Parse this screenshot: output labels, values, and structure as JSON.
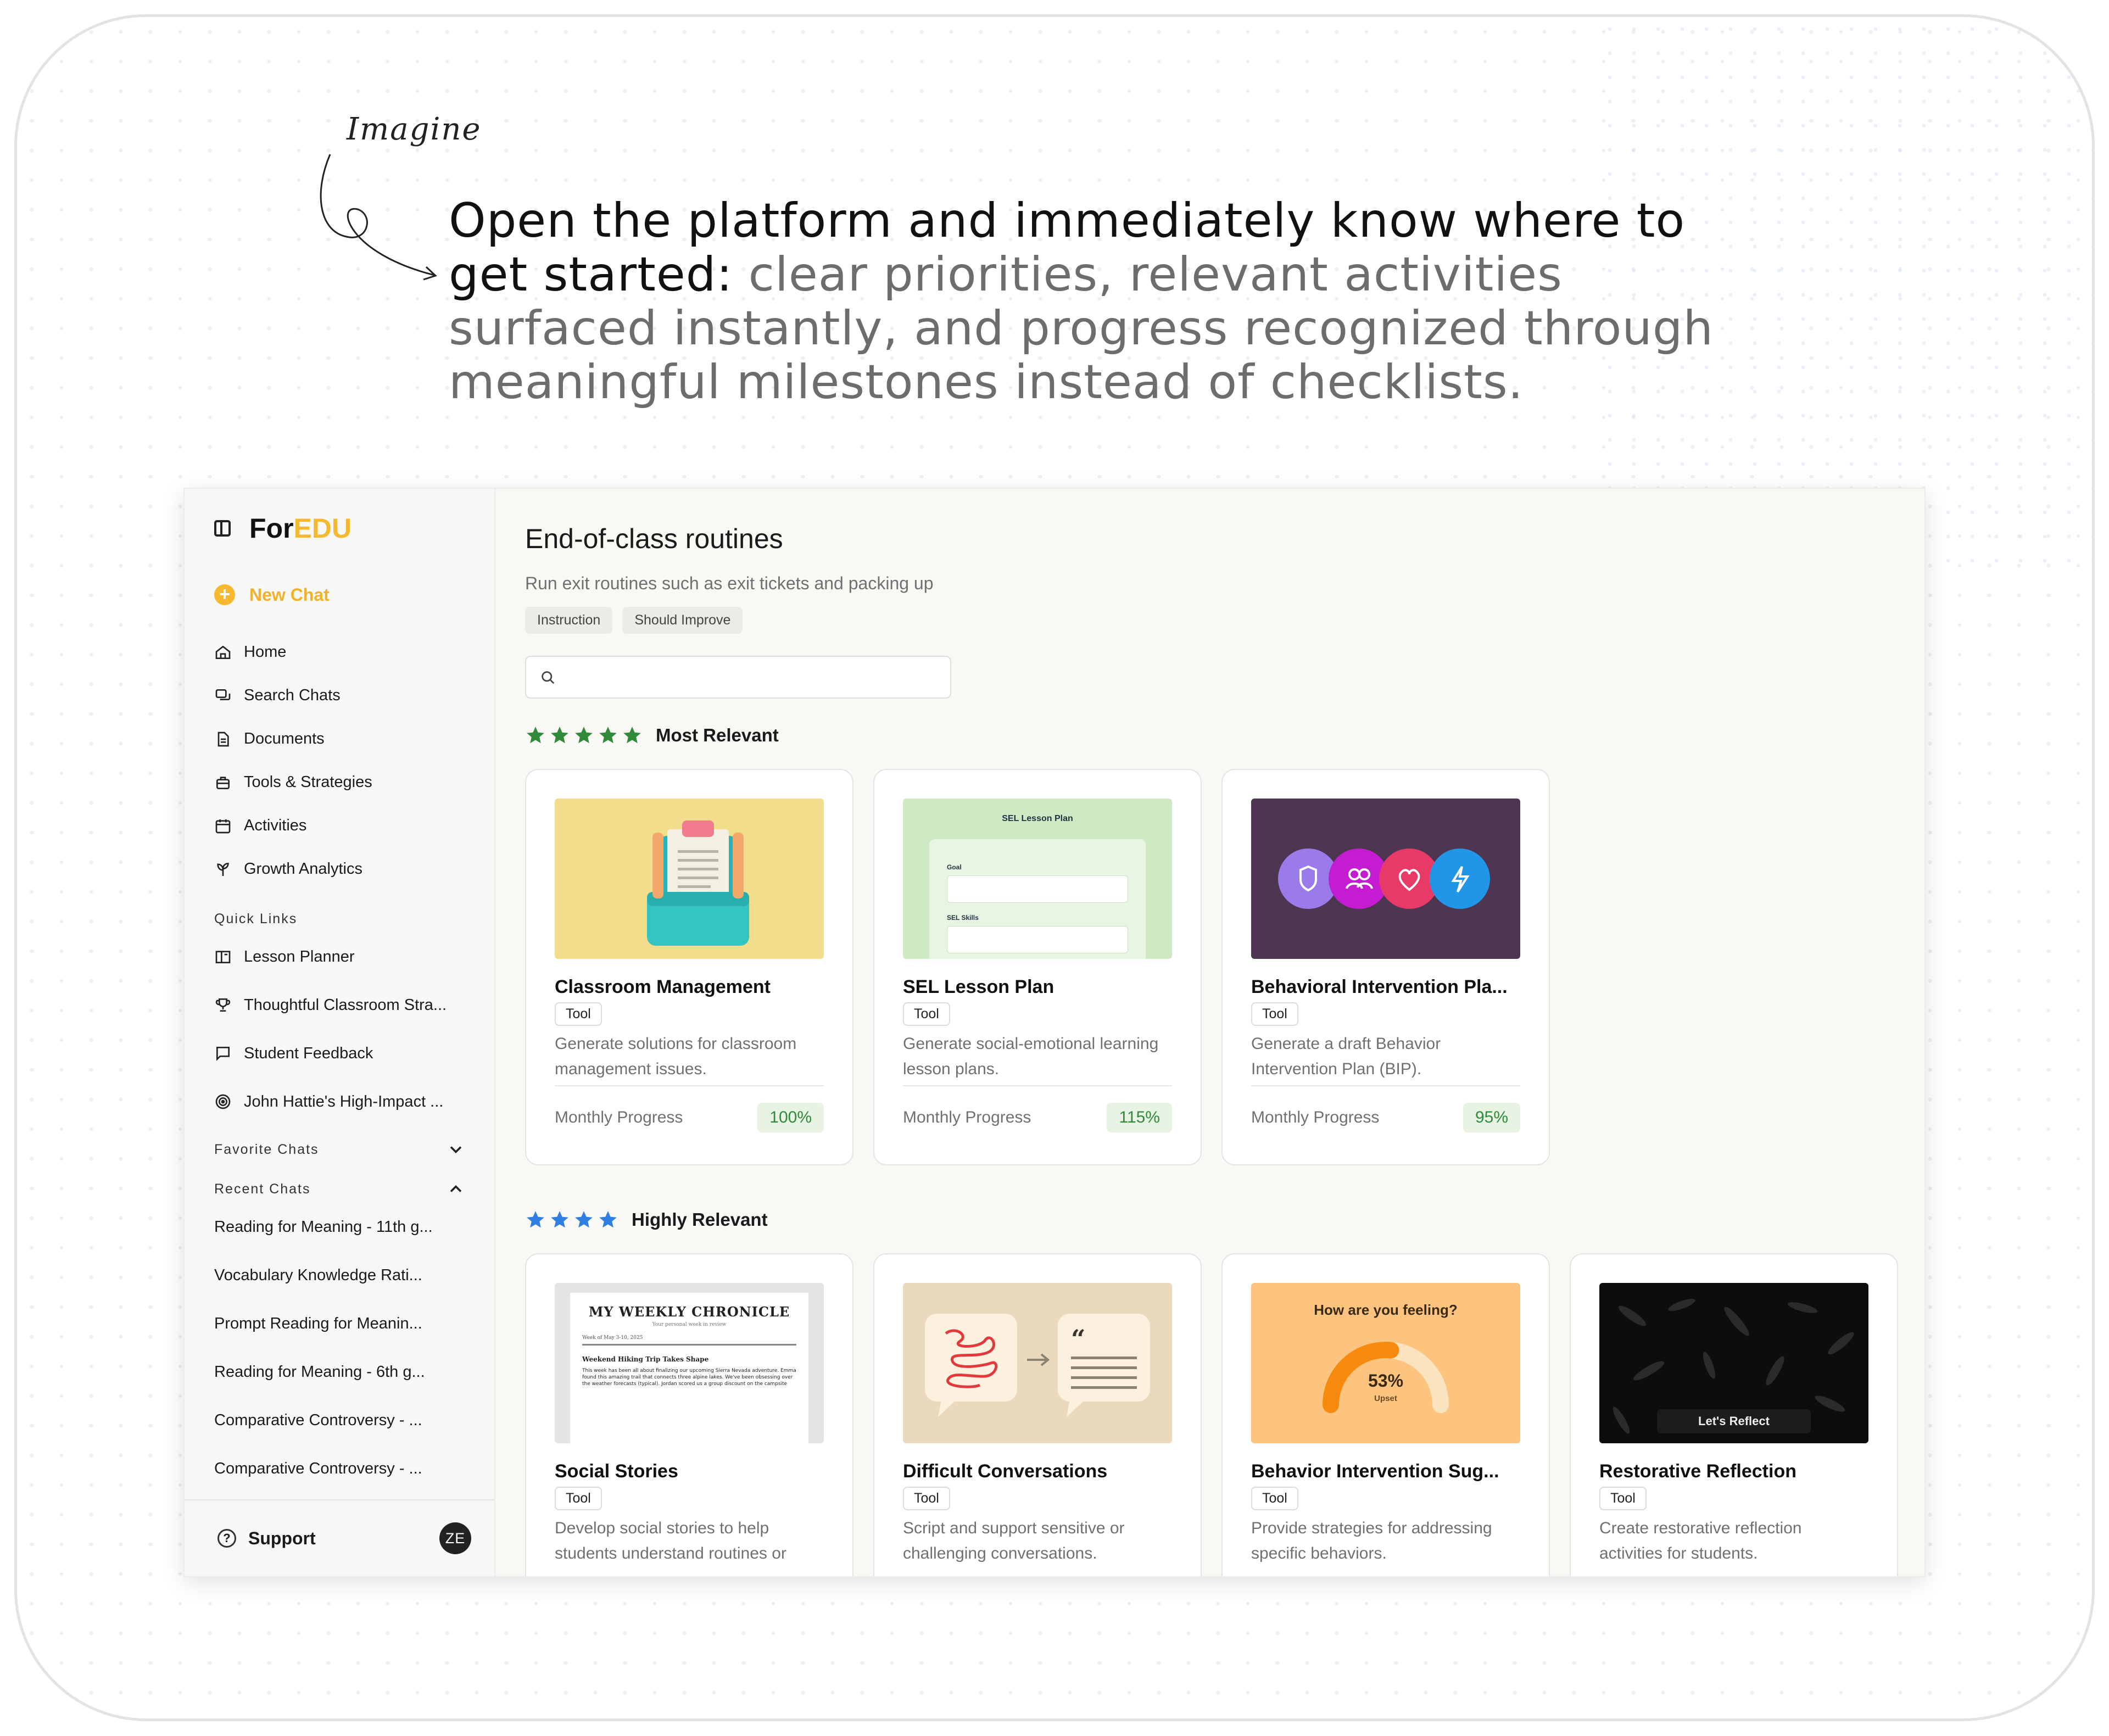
{
  "hero": {
    "imagine": "Imagine",
    "headline_strong": "Open the platform and immediately know where to get started:",
    "headline_muted": " clear priorities, relevant activities surfaced instantly, and progress recognized through meaningful milestones instead of checklists."
  },
  "brand": {
    "part1": "For",
    "part2": "EDU"
  },
  "sidebar": {
    "new_chat": "New Chat",
    "nav": [
      {
        "label": "Home",
        "icon": "home-icon"
      },
      {
        "label": "Search Chats",
        "icon": "chats-icon"
      },
      {
        "label": "Documents",
        "icon": "document-icon"
      },
      {
        "label": "Tools & Strategies",
        "icon": "tools-icon"
      },
      {
        "label": "Activities",
        "icon": "calendar-icon"
      },
      {
        "label": "Growth Analytics",
        "icon": "growth-icon"
      }
    ],
    "quick_links_label": "Quick Links",
    "quick_links": [
      {
        "label": "Lesson Planner",
        "icon": "book-icon"
      },
      {
        "label": "Thoughtful Classroom Stra...",
        "icon": "trophy-icon"
      },
      {
        "label": "Student Feedback",
        "icon": "comment-icon"
      },
      {
        "label": "John Hattie's High-Impact ...",
        "icon": "target-icon"
      }
    ],
    "favorite_chats_label": "Favorite Chats",
    "recent_chats_label": "Recent Chats",
    "recent_chats": [
      "Reading for Meaning - 11th g...",
      "Vocabulary Knowledge Rati...",
      "Prompt Reading for Meanin...",
      "Reading for Meaning - 6th g...",
      "Comparative Controversy - ...",
      "Comparative Controversy - ..."
    ],
    "support": "Support",
    "avatar": "ZE"
  },
  "main": {
    "title": "End-of-class routines",
    "subtitle": "Run exit routines such as exit tickets and packing up",
    "tags": [
      "Instruction",
      "Should Improve"
    ],
    "search_placeholder": "",
    "colors": {
      "star_green": "#2f8a3a",
      "star_blue": "#2f7fe0",
      "accent": "#f5b82e"
    },
    "groups": [
      {
        "label": "Most Relevant",
        "cards": [
          {
            "title": "Classroom Management",
            "badge": "Tool",
            "desc": "Generate solutions for classroom management issues.",
            "progress_label": "Monthly Progress",
            "progress": "100%"
          },
          {
            "title": "SEL Lesson Plan",
            "badge": "Tool",
            "desc": "Generate social-emotional learning lesson plans.",
            "progress_label": "Monthly Progress",
            "progress": "115%",
            "thumb": {
              "heading": "SEL Lesson Plan",
              "field1": "Goal",
              "field2": "SEL Skills"
            }
          },
          {
            "title": "Behavioral Intervention Pla...",
            "badge": "Tool",
            "desc": "Generate a draft Behavior Intervention Plan (BIP).",
            "progress_label": "Monthly Progress",
            "progress": "95%"
          }
        ]
      },
      {
        "label": "Highly Relevant",
        "cards": [
          {
            "title": "Social Stories",
            "badge": "Tool",
            "desc": "Develop social stories to help students understand routines or",
            "thumb": {
              "masthead": "MY WEEKLY CHRONICLE",
              "tagline": "Your personal week in review",
              "week": "Week of May 3-10, 2025",
              "headline": "Weekend Hiking Trip Takes Shape",
              "body": "This week has been all about finalizing our upcoming Sierra Nevada adventure. Emma found this amazing trail that connects three alpine lakes. We've been obsessing over the weather forecasts (typical). Jordan scored us a group discount on the campsite"
            }
          },
          {
            "title": "Difficult Conversations",
            "badge": "Tool",
            "desc": "Script and support sensitive or challenging conversations."
          },
          {
            "title": "Behavior Intervention Sug...",
            "badge": "Tool",
            "desc": "Provide strategies for addressing specific behaviors.",
            "thumb": {
              "question": "How are you feeling?",
              "value": "53%",
              "mood": "Upset",
              "fraction": 0.53
            }
          },
          {
            "title": "Restorative Reflection",
            "badge": "Tool",
            "desc": "Create restorative reflection activities for students.",
            "thumb": {
              "button": "Let's Reflect"
            }
          }
        ]
      }
    ]
  }
}
